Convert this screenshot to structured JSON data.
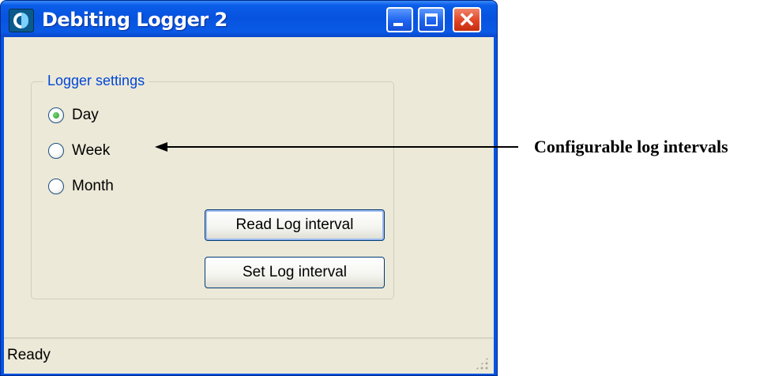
{
  "window": {
    "title": "Debiting Logger 2",
    "icon": "app-logo-icon",
    "controls": {
      "minimize": "minimize-icon",
      "maximize": "maximize-icon",
      "close": "close-icon",
      "close_glyph": "✕"
    }
  },
  "logger_settings": {
    "label": "Logger settings",
    "options": [
      {
        "label": "Day",
        "selected": true
      },
      {
        "label": "Week",
        "selected": false
      },
      {
        "label": "Month",
        "selected": false
      }
    ]
  },
  "buttons": {
    "read": "Read Log interval",
    "set": "Set Log interval"
  },
  "status": {
    "text": "Ready"
  },
  "annotation": {
    "text": "Configurable log intervals"
  },
  "colors": {
    "titlebar": "#0a5ee9",
    "groupbox_label": "#0046d5",
    "radio_selected": "#21a121",
    "close_button": "#e04424"
  }
}
